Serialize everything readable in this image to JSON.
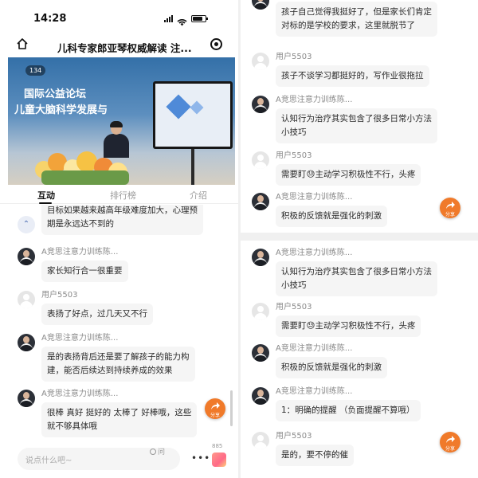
{
  "status_bar": {
    "time": "14:28"
  },
  "header": {
    "title": "儿科专家郎亚琴权威解读 注..."
  },
  "video": {
    "viewer_count": "134",
    "backdrop_line1": "国际公益论坛",
    "backdrop_line2": "儿童大脑科学发展与"
  },
  "tabs": [
    {
      "label": "互动",
      "active": true
    },
    {
      "label": "排行榜",
      "active": false
    },
    {
      "label": "介绍",
      "active": false
    }
  ],
  "left_chat": [
    {
      "name": "",
      "text": "目标如果越来越高年级难度加大，心理预\n期是永远达不到的",
      "avatar": "photo"
    },
    {
      "name": "A竞思注意力训练陈...",
      "text": "家长知行合一很重要",
      "avatar": "photo"
    },
    {
      "name": "用户5503",
      "text": "表扬了好点，过几天又不行",
      "avatar": "gray"
    },
    {
      "name": "A竞思注意力训练陈...",
      "text": "是的表扬背后还是要了解孩子的能力构\n建，能否后续达到持续养成的效果",
      "avatar": "photo"
    },
    {
      "name": "A竞思注意力训练陈...",
      "text": "很棒 真好 挺好的 太棒了 好棒哦，这些\n就不够具体哦",
      "avatar": "photo"
    }
  ],
  "right_top_chat": [
    {
      "name": "",
      "text": "孩子自己觉得我挺好了，但是家长们肯定\n对标的是学校的要求，这里就脱节了",
      "avatar": "photo"
    },
    {
      "name": "用户5503",
      "text": "孩子不谈学习都挺好的，写作业很拖拉",
      "avatar": "gray"
    },
    {
      "name": "A竞思注意力训练陈...",
      "text": "认知行为治疗其实包含了很多日常小方法\n小技巧",
      "avatar": "photo"
    },
    {
      "name": "用户5503",
      "text": "需要盯😓主动学习积极性不行，头疼",
      "avatar": "gray"
    },
    {
      "name": "A竞思注意力训练陈...",
      "text": "积极的反馈就是强化的刺激",
      "avatar": "photo"
    }
  ],
  "right_bottom_chat": [
    {
      "name": "A竞思注意力训练陈...",
      "text": "认知行为治疗其实包含了很多日常小方法\n小技巧",
      "avatar": "photo"
    },
    {
      "name": "用户5503",
      "text": "需要盯😓主动学习积极性不行，头疼",
      "avatar": "gray"
    },
    {
      "name": "A竞思注意力训练陈...",
      "text": "积极的反馈就是强化的刺激",
      "avatar": "photo"
    },
    {
      "name": "A竞思注意力训练陈...",
      "text": "1：明确的提醒 （负面提醒不算哦）",
      "avatar": "photo"
    },
    {
      "name": "用户5503",
      "text": "是的，要不停的催",
      "avatar": "gray"
    }
  ],
  "share_label": "分享",
  "bottom_bar": {
    "comment_placeholder": "说点什么吧~",
    "ask_label": "问",
    "like_count": "885"
  },
  "colors": {
    "share_orange": "#f07a2a",
    "ask_blue": "#4a6bb2"
  }
}
